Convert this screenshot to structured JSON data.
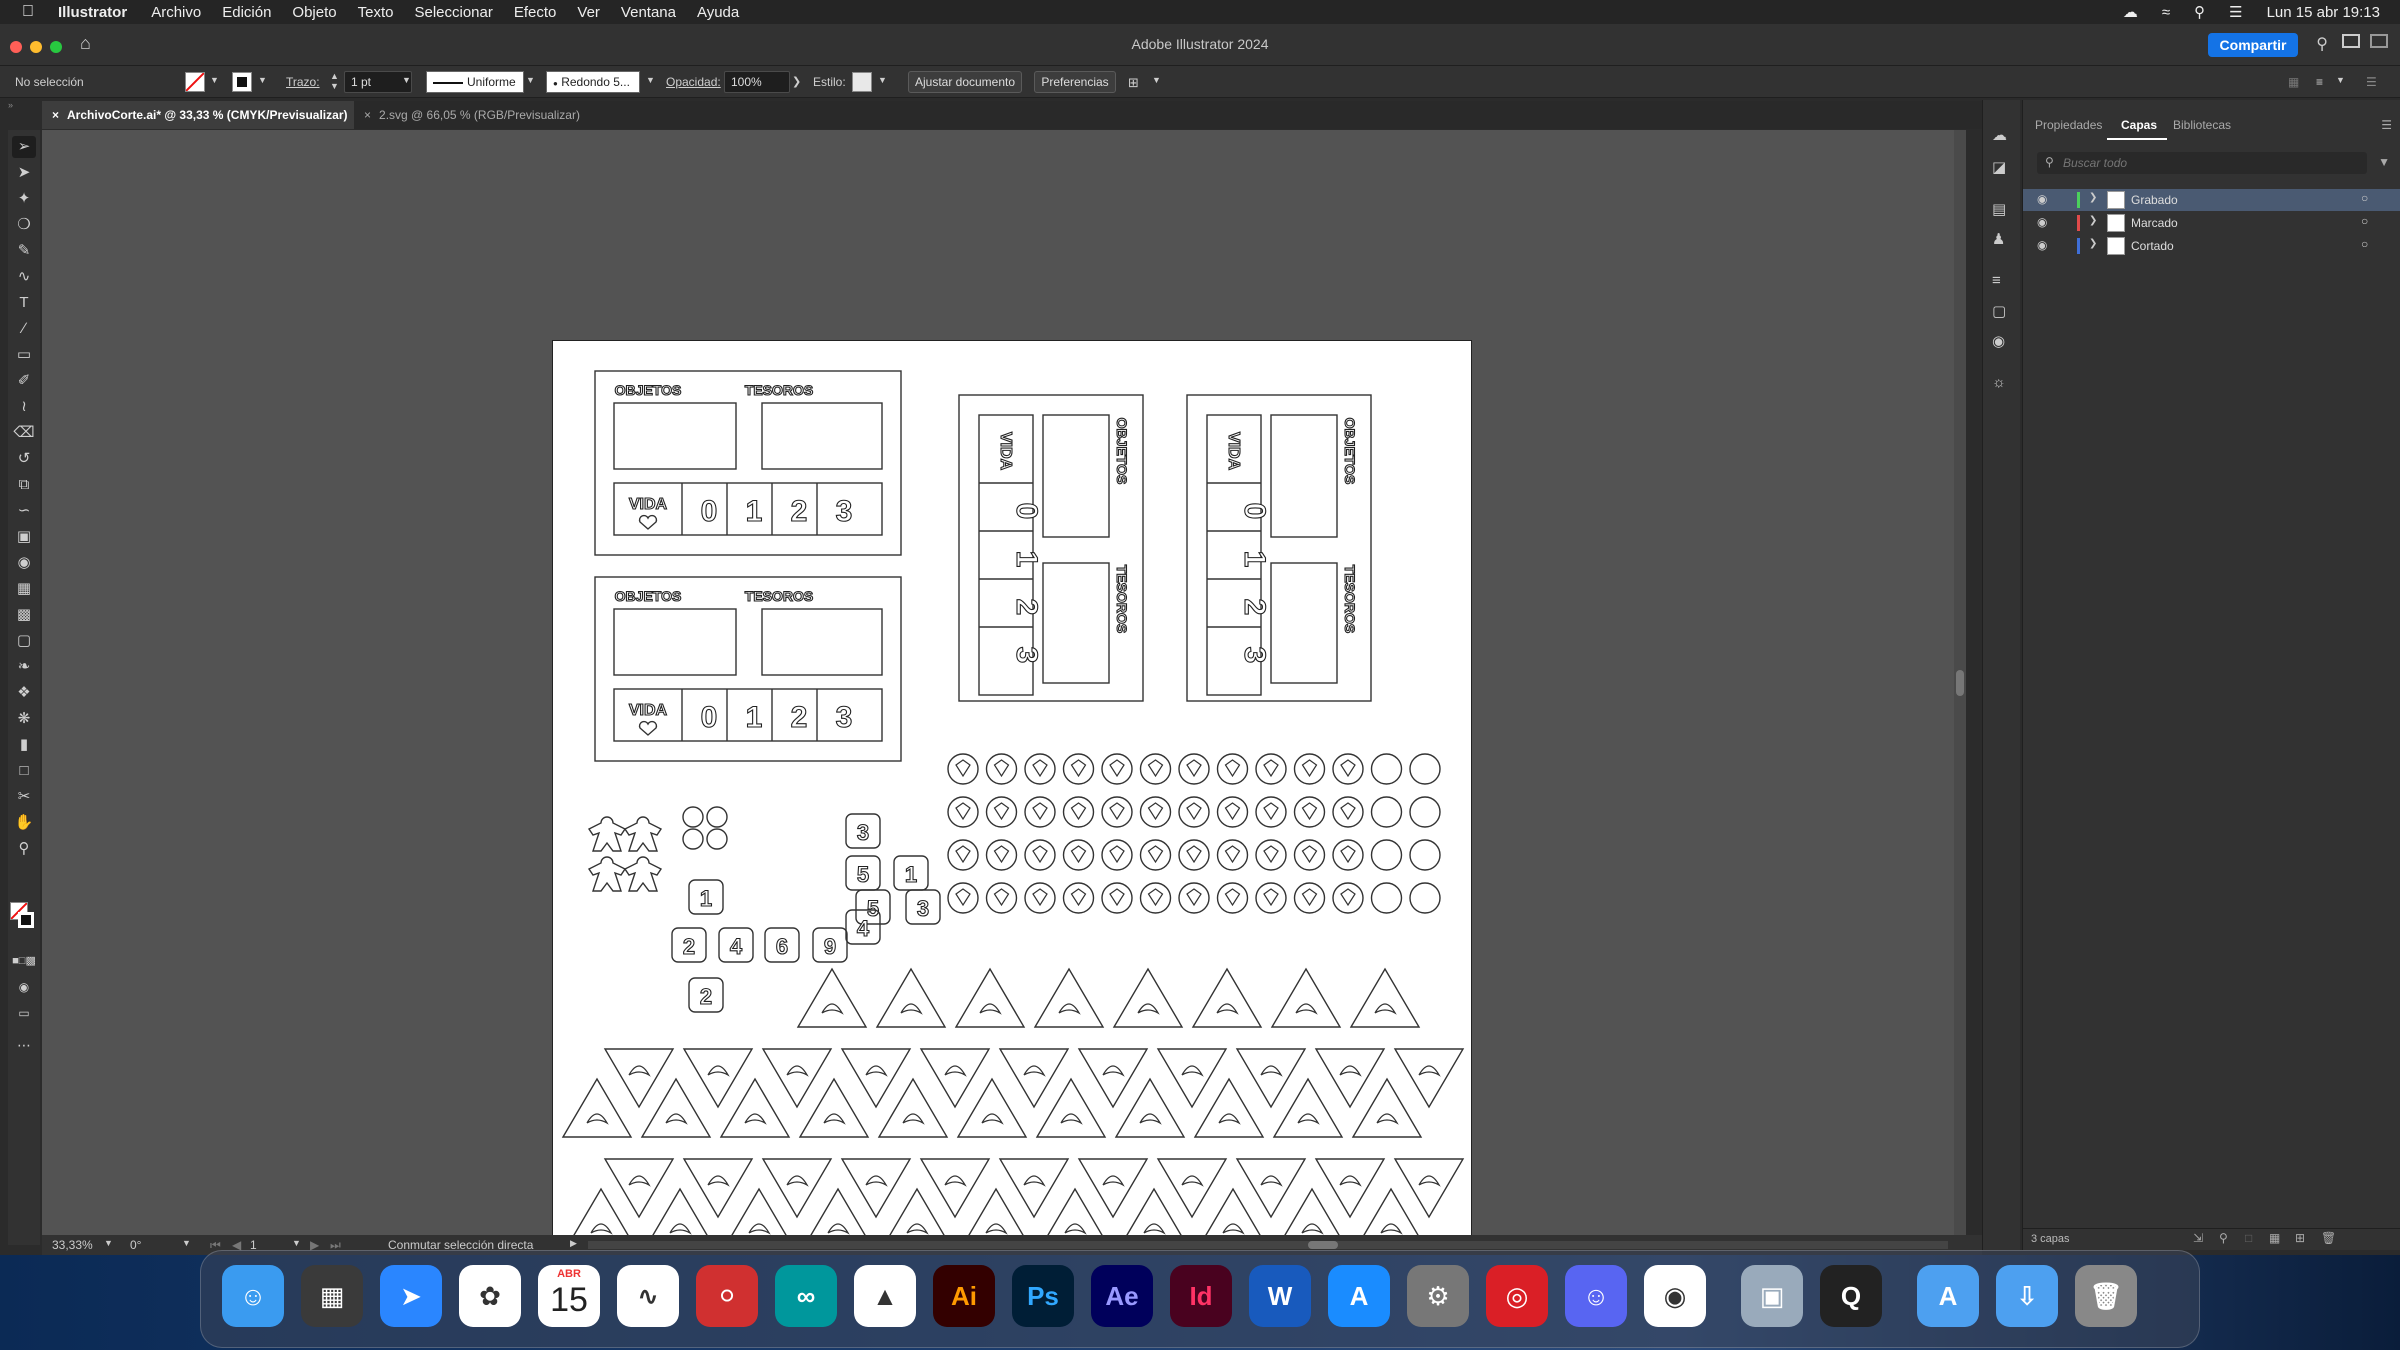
{
  "menubar": {
    "app": "Illustrator",
    "items": [
      "Archivo",
      "Edición",
      "Objeto",
      "Texto",
      "Seleccionar",
      "Efecto",
      "Ver",
      "Ventana",
      "Ayuda"
    ],
    "clock": "Lun 15 abr 19:13"
  },
  "window": {
    "title": "Adobe Illustrator 2024",
    "share": "Compartir"
  },
  "control": {
    "selection": "No selección",
    "stroke_label": "Trazo:",
    "stroke_value": "1 pt",
    "profile": "Uniforme",
    "brush": "Redondo 5...",
    "opacity_label": "Opacidad:",
    "opacity_value": "100%",
    "style_label": "Estilo:",
    "fit_doc": "Ajustar documento",
    "prefs": "Preferencias"
  },
  "tabs": [
    {
      "label": "ArchivoCorte.ai* @ 33,33 % (CMYK/Previsualizar)",
      "active": true
    },
    {
      "label": "2.svg @ 66,05 % (RGB/Previsualizar)",
      "active": false
    }
  ],
  "artwork": {
    "objetos": "OBJETOS",
    "tesoros": "TESOROS",
    "vida": "VIDA",
    "life_numbers": [
      "0",
      "1",
      "2",
      "3"
    ],
    "dice_numbers": [
      "1",
      "5",
      "3",
      "2",
      "4",
      "6",
      "9",
      "2",
      "3",
      "5",
      "4",
      "1"
    ]
  },
  "panel": {
    "tabs": [
      "Propiedades",
      "Capas",
      "Bibliotecas"
    ],
    "active_tab": "Capas",
    "search_placeholder": "Buscar todo",
    "layers": [
      {
        "name": "Grabado",
        "color": "#4bd05c",
        "selected": true
      },
      {
        "name": "Marcado",
        "color": "#e04a4a",
        "selected": false
      },
      {
        "name": "Cortado",
        "color": "#3f6fd8",
        "selected": false
      }
    ],
    "footer": "3 capas"
  },
  "status": {
    "zoom": "33,33%",
    "rotation": "0°",
    "artboard": "1",
    "hint": "Conmutar selección directa"
  },
  "dock": {
    "apps": [
      "Finder",
      "Launchpad",
      "Safari",
      "Fotos",
      "Calendario",
      "Freeform",
      "Instruments",
      "Arduino",
      "Inkscape",
      "Ai",
      "Ps",
      "Ae",
      "Id",
      "Word",
      "App Store",
      "Ajustes",
      "Creative Cloud",
      "Discord",
      "Chrome",
      "Preview",
      "QuickTime",
      "Aplicaciones",
      "Descargas",
      "Papelera"
    ],
    "calendar_month": "ABR",
    "calendar_day": "15"
  }
}
